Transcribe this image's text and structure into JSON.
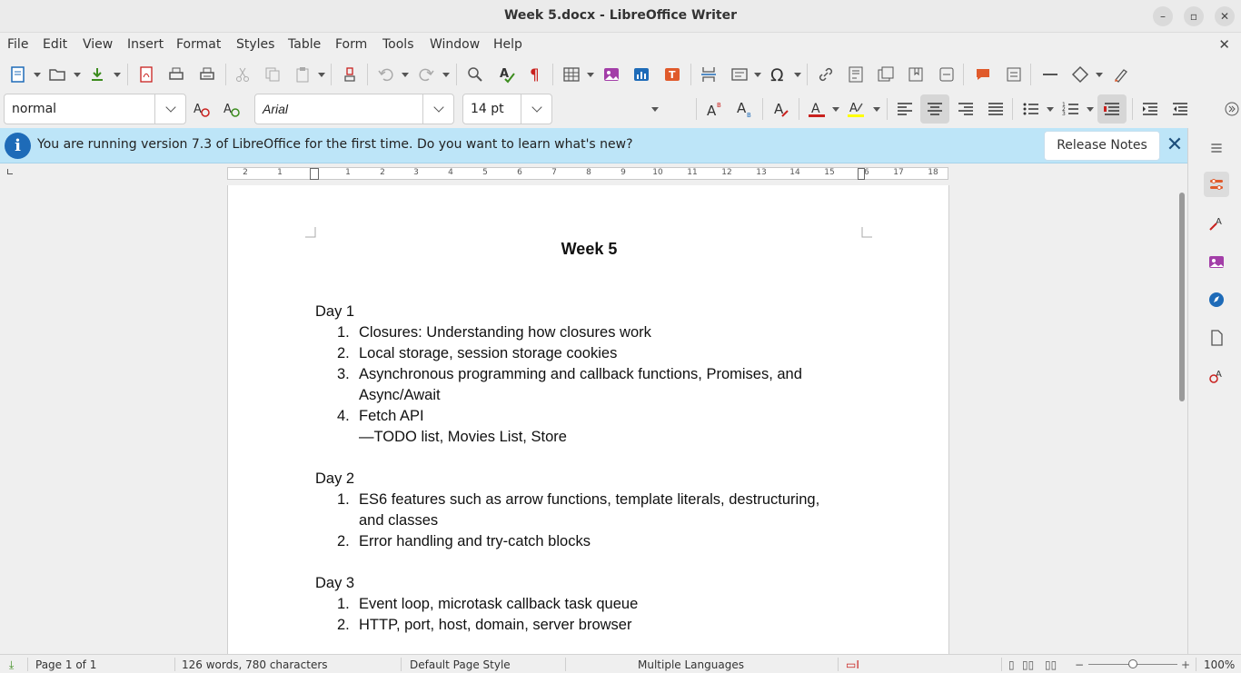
{
  "window": {
    "title": "Week 5.docx - LibreOffice Writer",
    "minimize": "–",
    "maximize": "▫",
    "close": "✕"
  },
  "menu": [
    "File",
    "Edit",
    "View",
    "Insert",
    "Format",
    "Styles",
    "Table",
    "Form",
    "Tools",
    "Window",
    "Help"
  ],
  "menu_close": "✕",
  "formatting": {
    "paragraph_style": "normal",
    "font_name": "Arial",
    "font_size": "14 pt"
  },
  "infobar": {
    "message": "You are running version 7.3 of LibreOffice for the first time. Do you want to learn what's new?",
    "release_notes_label": "Release Notes",
    "info_glyph": "i"
  },
  "ruler": {
    "labels": [
      "2",
      "1",
      "1",
      "2",
      "3",
      "4",
      "5",
      "6",
      "7",
      "8",
      "9",
      "10",
      "11",
      "12",
      "13",
      "14",
      "15",
      "16",
      "17",
      "18"
    ]
  },
  "document": {
    "title": "Week 5",
    "days": [
      {
        "heading": "Day 1",
        "items": [
          {
            "num": "1.",
            "lines": [
              "Closures: Understanding how closures work"
            ]
          },
          {
            "num": "2.",
            "lines": [
              "Local storage, session storage cookies"
            ]
          },
          {
            "num": "3.",
            "lines": [
              "Asynchronous programming and callback functions, Promises, and",
              "Async/Await"
            ]
          },
          {
            "num": "4.",
            "lines": [
              "Fetch API",
              "—TODO list, Movies List, Store"
            ]
          }
        ]
      },
      {
        "heading": "Day 2",
        "items": [
          {
            "num": "1.",
            "lines": [
              "ES6 features such as arrow functions, template literals, destructuring,",
              "and classes"
            ]
          },
          {
            "num": "2.",
            "lines": [
              "Error handling and try-catch blocks"
            ]
          }
        ]
      },
      {
        "heading": "Day 3",
        "items": [
          {
            "num": "1.",
            "lines": [
              "Event loop, microtask callback task queue"
            ]
          },
          {
            "num": "2.",
            "lines": [
              "HTTP, port, host, domain, server browser"
            ]
          }
        ]
      }
    ]
  },
  "statusbar": {
    "page": "Page 1 of 1",
    "words": "126 words, 780 characters",
    "page_style": "Default Page Style",
    "language": "Multiple Languages",
    "zoom": "100%"
  },
  "colors": {
    "infobar_bg": "#bde5f8",
    "accent_blue": "#1e6bb8",
    "font_color_red": "#c9211e",
    "highlight_yellow": "#ffff00"
  }
}
